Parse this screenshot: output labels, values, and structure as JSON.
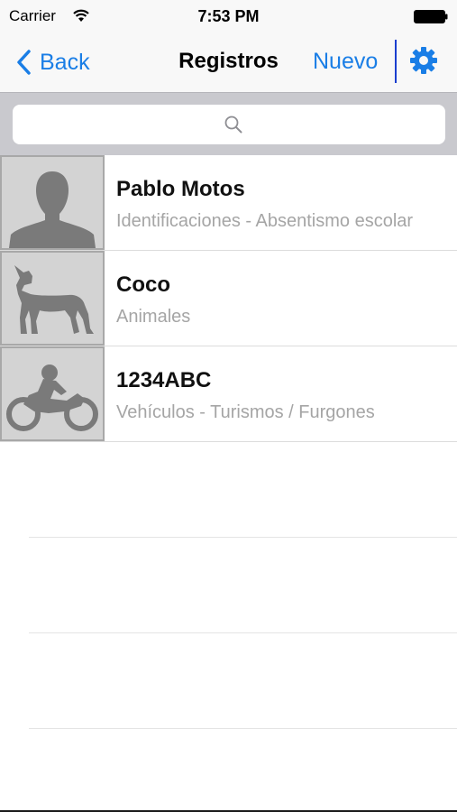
{
  "status_bar": {
    "carrier": "Carrier",
    "time": "7:53 PM",
    "icons": [
      "wifi-icon",
      "battery-icon"
    ]
  },
  "nav": {
    "back_label": "Back",
    "title": "Registros",
    "new_label": "Nuevo",
    "settings_icon": "gear-icon",
    "accent_color": "#1a7ee6"
  },
  "search": {
    "placeholder": "",
    "value": "",
    "icon": "search-icon"
  },
  "records": [
    {
      "title": "Pablo Motos",
      "subtitle": "Identificaciones - Absentismo escolar",
      "icon": "person-silhouette-icon"
    },
    {
      "title": "Coco",
      "subtitle": "Animales",
      "icon": "dog-silhouette-icon"
    },
    {
      "title": "1234ABC",
      "subtitle": "Vehículos - Turismos / Furgones",
      "icon": "motorcycle-icon"
    }
  ]
}
